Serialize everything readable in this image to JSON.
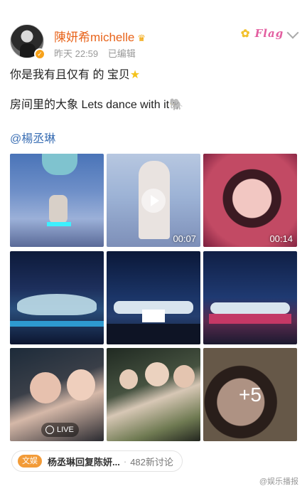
{
  "post": {
    "username": "陳妍希michelle",
    "time": "昨天 22:59",
    "edited": "已编辑",
    "sticker_text": "Flag",
    "lines": [
      "你是我有且仅有 的 宝贝",
      "房间里的大象 Lets dance with it",
      "@楊丞琳"
    ]
  },
  "media": {
    "durations": [
      "00:07",
      "00:14"
    ],
    "live_label": "LIVE",
    "more_count": "+5"
  },
  "topic": {
    "tag": "文娱",
    "title": "杨丞琳回复陈妍...",
    "separator": "·",
    "count": "482新讨论"
  },
  "watermark": "@娱乐播报",
  "colors": {
    "username": "#e8641b",
    "mention": "#3b6fb4",
    "topic_tag": "#f29b38"
  },
  "icons": [
    "verified-icon",
    "crown-icon",
    "star-icon",
    "elephant-icon",
    "play-icon",
    "live-icon",
    "chevron-down-icon"
  ]
}
